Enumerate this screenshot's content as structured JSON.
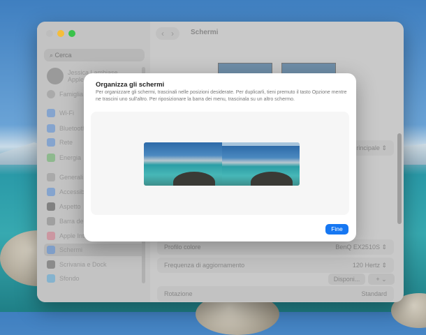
{
  "window": {
    "title": "Schermi",
    "search_placeholder": "Cerca",
    "user_name": "Jessica Lambiase",
    "user_sub": "Apple Account",
    "family": "Famiglia"
  },
  "sidebar": {
    "items": [
      {
        "label": "Wi-Fi",
        "color": "#5b8fd6"
      },
      {
        "label": "Bluetooth",
        "color": "#5b8fd6"
      },
      {
        "label": "Rete",
        "color": "#5b8fd6"
      },
      {
        "label": "Energia",
        "color": "#6ab36a"
      },
      {
        "label": "Generali",
        "color": "#999999"
      },
      {
        "label": "Accessibilità",
        "color": "#5b8fd6"
      },
      {
        "label": "Aspetto",
        "color": "#555555"
      },
      {
        "label": "Barra dei menu",
        "color": "#888888"
      },
      {
        "label": "Apple Intelligence",
        "color": "#d07a8a"
      },
      {
        "label": "Schermi",
        "color": "#5b8fd6"
      },
      {
        "label": "Scrivania e Dock",
        "color": "#666666"
      },
      {
        "label": "Sfondo",
        "color": "#5ba8d6"
      }
    ]
  },
  "main": {
    "rows": [
      {
        "label": "",
        "value": "Principale"
      },
      {
        "label": "Profilo colore",
        "value": "BenQ EX2510S"
      },
      {
        "label": "Frequenza di aggiornamento",
        "value": "120 Hertz"
      },
      {
        "label": "Rotazione",
        "value": "Standard"
      }
    ],
    "arrange_button": "Disponi...",
    "add_button": "+",
    "chevron": "⌄"
  },
  "dialog": {
    "title": "Organizza gli schermi",
    "description": "Per organizzare gli schermi, trascinali nelle posizioni desiderate. Per duplicarli, tieni premuto il tasto Opzione mentre ne trascini uno sull'altro. Per riposizionare la barra dei menu, trascinala su un altro schermo.",
    "done_button": "Fine"
  }
}
